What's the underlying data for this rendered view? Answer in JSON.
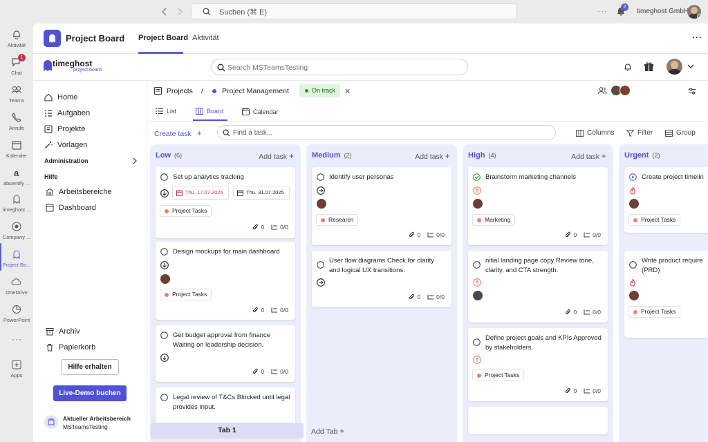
{
  "topbar": {
    "search_placeholder": "Suchen (⌘ E)",
    "org_name": "timeghost GmbH",
    "notif_count": "2"
  },
  "rail": {
    "items": [
      {
        "label": "Aktivität",
        "icon": "bell-icon"
      },
      {
        "label": "Chat",
        "icon": "chat-icon",
        "badge": "1"
      },
      {
        "label": "Teams",
        "icon": "teams-icon"
      },
      {
        "label": "Anrufe",
        "icon": "phone-icon"
      },
      {
        "label": "Kalender",
        "icon": "calendar-icon"
      },
      {
        "label": "absentify ...",
        "icon": "absentify-icon"
      },
      {
        "label": "timeghost ...",
        "icon": "timeghost-icon"
      },
      {
        "label": "Company ...",
        "icon": "company-icon"
      },
      {
        "label": "Project Bo...",
        "icon": "project-board-icon"
      },
      {
        "label": "OneDrive",
        "icon": "cloud-icon"
      },
      {
        "label": "PowerPoint",
        "icon": "powerpoint-icon"
      },
      {
        "label": "Apps",
        "icon": "apps-icon"
      }
    ]
  },
  "apphead": {
    "title": "Project Board",
    "tabs": [
      "Project Board",
      "Aktivität"
    ]
  },
  "header": {
    "logo_top": "timeghost",
    "logo_bottom": "project board",
    "search_placeholder": "Search MSTeamsTesting"
  },
  "sidebar": {
    "nav": [
      "Home",
      "Aufgaben",
      "Projekte",
      "Vorlagen"
    ],
    "section_admin": "Administration",
    "section_help": "Hilfe",
    "help_items": [
      "Arbeitsbereiche",
      "Dashboard"
    ],
    "bottom_items": [
      "Archiv",
      "Papierkorb"
    ],
    "help_button": "Hilfe erhalten",
    "demo_button": "Live-Demo buchen",
    "workspace_label": "Aktueller Arbeitsbereich",
    "workspace_name": "MSTeamsTesting"
  },
  "breadcrumb": {
    "projects": "Projects",
    "separator": "/",
    "project": "Project Management",
    "status": "On track"
  },
  "views": [
    "List",
    "Board",
    "Calendar"
  ],
  "toolbar": {
    "create_task": "Create task",
    "search_placeholder": "Find a task...",
    "columns": "Columns",
    "filter": "Filter",
    "group": "Group"
  },
  "columns": [
    {
      "title": "Low",
      "count": "(6)",
      "add": "Add task",
      "cards": [
        {
          "title": "Set up analytics tracking",
          "start": "Thu. 17.07.2025",
          "end": "Thu. 31.07.2025",
          "tag": "Project Tasks",
          "attach": "0",
          "sub": "0/0"
        },
        {
          "title": "Design mockups for main dashboard",
          "tag": "Project Tasks",
          "attach": "0",
          "sub": "0/0"
        },
        {
          "title": "Get budget approval from finance Waiting on leadership decision.",
          "attach": "0",
          "sub": "0/0"
        },
        {
          "title": "Legal review of T&Cs Blocked until legal provides input."
        }
      ]
    },
    {
      "title": "Medium",
      "count": "(2)",
      "add": "Add task",
      "cards": [
        {
          "title": "Identify user personas",
          "tag": "Research",
          "attach": "0",
          "sub": "0/0"
        },
        {
          "title": "User flow diagrams Check for clarity and logical UX transitions.",
          "attach": "0",
          "sub": "0/0"
        }
      ]
    },
    {
      "title": "High",
      "count": "(4)",
      "add": "Add task",
      "cards": [
        {
          "title": "Brainstorm marketing channels",
          "tag": "Marketing",
          "attach": "0",
          "sub": "0/0"
        },
        {
          "title": "nitial landing page copy Review tone, clarity, and CTA strength.",
          "attach": "0",
          "sub": "0/0"
        },
        {
          "title": "Define project goals and KPIs Approved by stakeholders.",
          "tag": "Project Tasks",
          "attach": "0",
          "sub": "0/0"
        }
      ]
    },
    {
      "title": "Urgent",
      "count": "(2)",
      "add": "",
      "cards": [
        {
          "title": "Create project timelin",
          "tag": "Project Tasks"
        },
        {
          "title": "Write product require (PRD)",
          "tag": "Project Tasks"
        }
      ]
    }
  ],
  "bottom_tabs": {
    "tab1": "Tab 1",
    "add": "Add Tab"
  },
  "colors": {
    "accent": "#4f52d3",
    "tag_project": "#e8826b",
    "tag_research": "#e8826b",
    "tag_marketing": "#e8826b",
    "on_track": "#13a10e"
  }
}
